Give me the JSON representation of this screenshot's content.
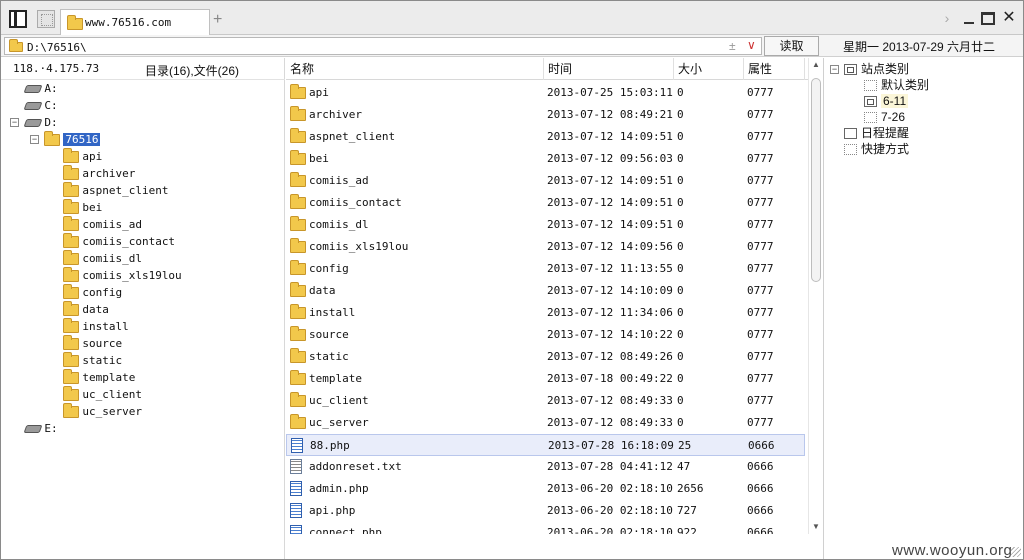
{
  "tab": {
    "title": "www.76516.com"
  },
  "address": {
    "path": "D:\\76516\\",
    "plus": "±",
    "read_label": "读取"
  },
  "date_text": "星期一 2013-07-29 六月廿二",
  "host_ip": "118.·4.175.73",
  "dir_summary": "目录(16),文件(26)",
  "tree": {
    "drives": [
      "A:",
      "C:",
      "D:",
      "E:"
    ],
    "selected": "76516",
    "children": [
      "api",
      "archiver",
      "aspnet_client",
      "bei",
      "comiis_ad",
      "comiis_contact",
      "comiis_dl",
      "comiis_xls19lou",
      "config",
      "data",
      "install",
      "source",
      "static",
      "template",
      "uc_client",
      "uc_server"
    ]
  },
  "columns": {
    "name": "名称",
    "time": "时间",
    "size": "大小",
    "attr": "属性"
  },
  "files": [
    {
      "name": "api",
      "time": "2013-07-25 15:03:11",
      "size": "0",
      "attr": "0777",
      "kind": "folder"
    },
    {
      "name": "archiver",
      "time": "2013-07-12 08:49:21",
      "size": "0",
      "attr": "0777",
      "kind": "folder"
    },
    {
      "name": "aspnet_client",
      "time": "2013-07-12 14:09:51",
      "size": "0",
      "attr": "0777",
      "kind": "folder"
    },
    {
      "name": "bei",
      "time": "2013-07-12 09:56:03",
      "size": "0",
      "attr": "0777",
      "kind": "folder"
    },
    {
      "name": "comiis_ad",
      "time": "2013-07-12 14:09:51",
      "size": "0",
      "attr": "0777",
      "kind": "folder"
    },
    {
      "name": "comiis_contact",
      "time": "2013-07-12 14:09:51",
      "size": "0",
      "attr": "0777",
      "kind": "folder"
    },
    {
      "name": "comiis_dl",
      "time": "2013-07-12 14:09:51",
      "size": "0",
      "attr": "0777",
      "kind": "folder"
    },
    {
      "name": "comiis_xls19lou",
      "time": "2013-07-12 14:09:56",
      "size": "0",
      "attr": "0777",
      "kind": "folder"
    },
    {
      "name": "config",
      "time": "2013-07-12 11:13:55",
      "size": "0",
      "attr": "0777",
      "kind": "folder"
    },
    {
      "name": "data",
      "time": "2013-07-12 14:10:09",
      "size": "0",
      "attr": "0777",
      "kind": "folder"
    },
    {
      "name": "install",
      "time": "2013-07-12 11:34:06",
      "size": "0",
      "attr": "0777",
      "kind": "folder"
    },
    {
      "name": "source",
      "time": "2013-07-12 14:10:22",
      "size": "0",
      "attr": "0777",
      "kind": "folder"
    },
    {
      "name": "static",
      "time": "2013-07-12 08:49:26",
      "size": "0",
      "attr": "0777",
      "kind": "folder"
    },
    {
      "name": "template",
      "time": "2013-07-18 00:49:22",
      "size": "0",
      "attr": "0777",
      "kind": "folder"
    },
    {
      "name": "uc_client",
      "time": "2013-07-12 08:49:33",
      "size": "0",
      "attr": "0777",
      "kind": "folder"
    },
    {
      "name": "uc_server",
      "time": "2013-07-12 08:49:33",
      "size": "0",
      "attr": "0777",
      "kind": "folder"
    },
    {
      "name": "88.php",
      "time": "2013-07-28 16:18:09",
      "size": "25",
      "attr": "0666",
      "kind": "php"
    },
    {
      "name": "addonreset.txt",
      "time": "2013-07-28 04:41:12",
      "size": "47",
      "attr": "0666",
      "kind": "txt"
    },
    {
      "name": "admin.php",
      "time": "2013-06-20 02:18:10",
      "size": "2656",
      "attr": "0666",
      "kind": "php"
    },
    {
      "name": "api.php",
      "time": "2013-06-20 02:18:10",
      "size": "727",
      "attr": "0666",
      "kind": "php"
    },
    {
      "name": "connect.php",
      "time": "2013-06-20 02:18:10",
      "size": "922",
      "attr": "0666",
      "kind": "php"
    }
  ],
  "right": {
    "site_category": "站点类别",
    "default_category": "默认类别",
    "cat_a": "6-11",
    "cat_b": "7-26",
    "schedule": "日程提醒",
    "shortcuts": "快捷方式"
  },
  "watermark": "www.wooyun.org",
  "colors": {
    "selection": "#3165c5",
    "highlight_row": "#e9edfa",
    "folder": "#f2c84b"
  }
}
